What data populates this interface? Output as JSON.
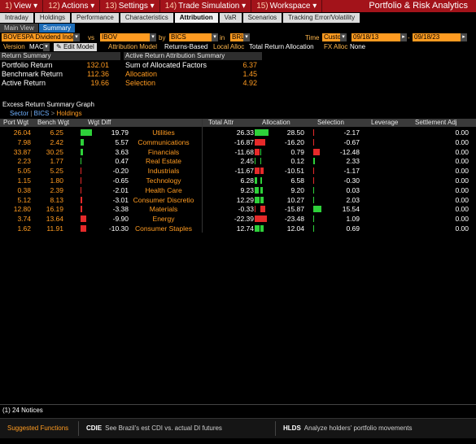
{
  "menu": {
    "items": [
      {
        "num": "1)",
        "label": "View"
      },
      {
        "num": "12)",
        "label": "Actions"
      },
      {
        "num": "13)",
        "label": "Settings"
      },
      {
        "num": "14)",
        "label": "Trade Simulation"
      },
      {
        "num": "15)",
        "label": "Workspace"
      }
    ],
    "title": "Portfolio & Risk Analytics"
  },
  "tabs": [
    "Intraday",
    "Holdings",
    "Performance",
    "Characteristics",
    "Attribution",
    "VaR",
    "Scenarios",
    "Tracking Error/Volatility"
  ],
  "active_tab": "Attribution",
  "subtabs": [
    "Main View",
    "Summary"
  ],
  "params": {
    "portfolio": "BOVESPA Dividend Inde",
    "vs_label": "vs",
    "benchmark": "IBOV",
    "by_label": "by",
    "grouping": "BICS",
    "in_label": "in",
    "currency": "BRL",
    "time_label": "Time",
    "time_mode": "Custo",
    "date_from": "09/18/13",
    "date_to": "09/18/23",
    "version_label": "Version",
    "version": "MAC",
    "edit_model": "Edit Model",
    "attribution_model_label": "Attribution Model",
    "attribution_model": "Returns-Based",
    "local_alloc_label": "Local Alloc",
    "local_alloc": "Total Return Allocation",
    "fx_alloc_label": "FX Alloc",
    "fx_alloc": "None"
  },
  "return_summary": {
    "header": "Return Summary",
    "rows": [
      {
        "label": "Portfolio Return",
        "value": "132.01"
      },
      {
        "label": "Benchmark Return",
        "value": "112.36"
      },
      {
        "label": "Active Return",
        "value": "19.66"
      }
    ]
  },
  "attribution_summary": {
    "header": "Active Return Attribution Summary",
    "rows": [
      {
        "label": "Sum of Allocated Factors",
        "value": "6.37"
      },
      {
        "label": "Allocation",
        "value": "1.45"
      },
      {
        "label": "Selection",
        "value": "4.92"
      }
    ]
  },
  "graph": {
    "title": "Excess Return Summary Graph",
    "crumb_1": "Sector",
    "crumb_2": "BICS",
    "crumb_3": "Holdings"
  },
  "table": {
    "headers": {
      "port": "Port Wgt",
      "bench": "Bench Wgt",
      "wgt": "Wgt Diff",
      "total": "Total Attr",
      "alloc": "Allocation",
      "sel": "Selection",
      "lev": "Leverage",
      "settle": "Settlement Adj"
    },
    "rows": [
      {
        "port": "26.04",
        "bench": "6.25",
        "wgt": "19.79",
        "name": "Utilities",
        "total": "26.33",
        "alloc": "28.50",
        "sel": "-2.17",
        "settle": "0.00"
      },
      {
        "port": "7.98",
        "bench": "2.42",
        "wgt": "5.57",
        "name": "Communications",
        "total": "-16.87",
        "alloc": "-16.20",
        "sel": "-0.67",
        "settle": "0.00"
      },
      {
        "port": "33.87",
        "bench": "30.25",
        "wgt": "3.63",
        "name": "Financials",
        "total": "-11.68",
        "alloc": "0.79",
        "sel": "-12.48",
        "settle": "0.00"
      },
      {
        "port": "2.23",
        "bench": "1.77",
        "wgt": "0.47",
        "name": "Real Estate",
        "total": "2.45",
        "alloc": "0.12",
        "sel": "2.33",
        "settle": "0.00"
      },
      {
        "port": "5.05",
        "bench": "5.25",
        "wgt": "-0.20",
        "name": "Industrials",
        "total": "-11.67",
        "alloc": "-10.51",
        "sel": "-1.17",
        "settle": "0.00"
      },
      {
        "port": "1.15",
        "bench": "1.80",
        "wgt": "-0.65",
        "name": "Technology",
        "total": "6.28",
        "alloc": "6.58",
        "sel": "-0.30",
        "settle": "0.00"
      },
      {
        "port": "0.38",
        "bench": "2.39",
        "wgt": "-2.01",
        "name": "Health Care",
        "total": "9.23",
        "alloc": "9.20",
        "sel": "0.03",
        "settle": "0.00"
      },
      {
        "port": "5.12",
        "bench": "8.13",
        "wgt": "-3.01",
        "name": "Consumer Discretio",
        "total": "12.29",
        "alloc": "10.27",
        "sel": "2.03",
        "settle": "0.00"
      },
      {
        "port": "12.80",
        "bench": "16.19",
        "wgt": "-3.38",
        "name": "Materials",
        "total": "-0.33",
        "alloc": "-15.87",
        "sel": "15.54",
        "settle": "0.00"
      },
      {
        "port": "3.74",
        "bench": "13.64",
        "wgt": "-9.90",
        "name": "Energy",
        "total": "-22.39",
        "alloc": "-23.48",
        "sel": "1.09",
        "settle": "0.00"
      },
      {
        "port": "1.62",
        "bench": "11.91",
        "wgt": "-10.30",
        "name": "Consumer Staples",
        "total": "12.74",
        "alloc": "12.04",
        "sel": "0.69",
        "settle": "0.00"
      }
    ]
  },
  "notices": "(1) 24 Notices",
  "footer": {
    "suggested": "Suggested Functions",
    "items": [
      {
        "code": "CDIE",
        "desc": "See Brazil's est CDI vs. actual DI futures"
      },
      {
        "code": "HLDS",
        "desc": "Analyze holders' portfolio movements"
      }
    ]
  },
  "colors": {
    "accent_orange": "#ff9b21",
    "menu_red": "#a3131a",
    "positive": "#2ed13a",
    "negative": "#e62a2a",
    "tab_blue": "#1c6cb8"
  }
}
